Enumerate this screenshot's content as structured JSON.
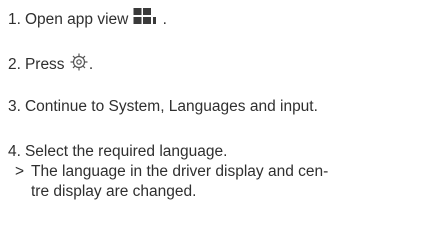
{
  "steps": [
    {
      "number": "1.",
      "text": "Open app view",
      "suffix": ".",
      "icon": "app-view-grid-icon"
    },
    {
      "number": "2.",
      "text": "Press",
      "suffix": ".",
      "icon": "settings-gear-icon"
    },
    {
      "number": "3.",
      "text": "Continue to System, Languages and input."
    },
    {
      "number": "4.",
      "text": "Select the required language."
    }
  ],
  "result": {
    "marker": ">",
    "line1": "The language in the driver display and cen-",
    "line2": "tre display are changed."
  },
  "colors": {
    "text": "#2f2f2f",
    "icon": "#555555"
  }
}
